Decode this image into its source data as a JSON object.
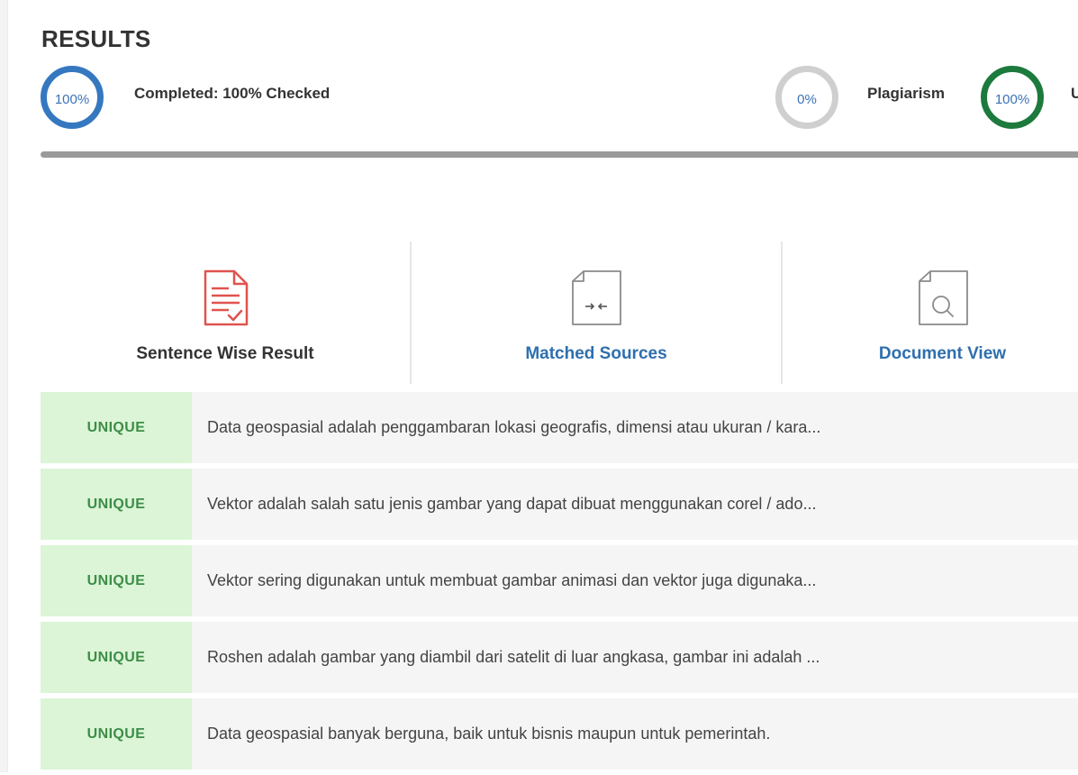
{
  "header": {
    "title": "RESULTS"
  },
  "stats": {
    "completed": {
      "percent": "100%",
      "label": "Completed: 100% Checked",
      "color": "#3578c0"
    },
    "plagiarism": {
      "percent": "0%",
      "label": "Plagiarism",
      "color": "#cfcfcf"
    },
    "unique": {
      "percent": "100%",
      "label": "U",
      "color": "#1c7a3c"
    }
  },
  "progress": {
    "value": 1.0
  },
  "tabs": [
    {
      "label": "Sentence Wise Result",
      "icon": "document-check-icon",
      "active": true
    },
    {
      "label": "Matched Sources",
      "icon": "document-compare-icon",
      "active": false
    },
    {
      "label": "Document View",
      "icon": "document-search-icon",
      "active": false
    }
  ],
  "results": [
    {
      "status": "UNIQUE",
      "text": "Data geospasial adalah penggambaran lokasi geografis, dimensi atau ukuran / kara..."
    },
    {
      "status": "UNIQUE",
      "text": "Vektor adalah salah satu jenis gambar yang dapat dibuat menggunakan corel / ado..."
    },
    {
      "status": "UNIQUE",
      "text": "Vektor sering digunakan untuk membuat gambar animasi dan vektor juga digunaka..."
    },
    {
      "status": "UNIQUE",
      "text": "Roshen adalah gambar yang diambil dari satelit di luar angkasa, gambar ini adalah ..."
    },
    {
      "status": "UNIQUE",
      "text": "Data geospasial banyak berguna, baik untuk bisnis maupun untuk pemerintah."
    }
  ],
  "colors": {
    "accent_blue": "#2e6fae",
    "unique_badge_bg": "#dbf5d6",
    "unique_badge_text": "#3d8d48",
    "sentence_icon_red": "#e0534f"
  }
}
